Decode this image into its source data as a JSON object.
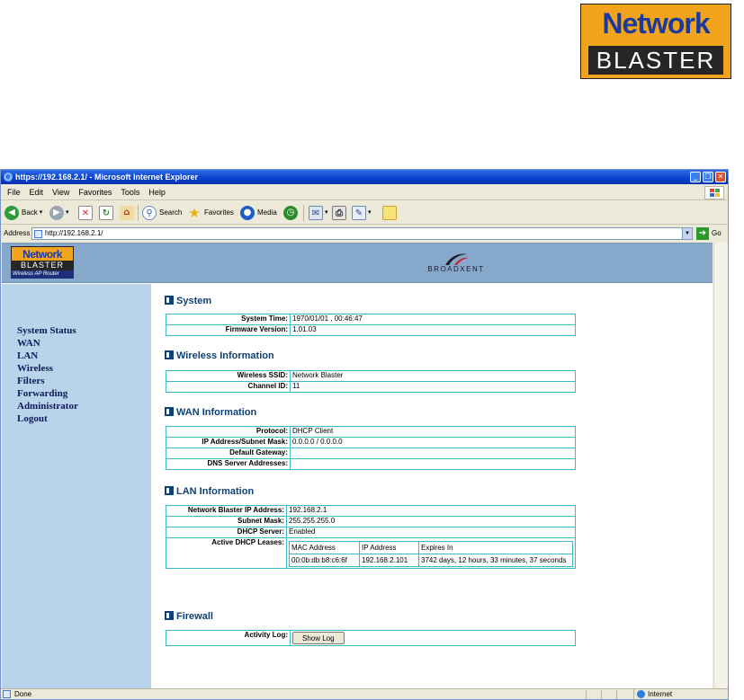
{
  "top_logo": {
    "word": "Network",
    "band": "BLASTER"
  },
  "browser": {
    "title": "https://192.168.2.1/ - Microsoft Internet Explorer",
    "menu": [
      "File",
      "Edit",
      "View",
      "Favorites",
      "Tools",
      "Help"
    ],
    "toolbar": {
      "back": "Back",
      "search": "Search",
      "favorites": "Favorites",
      "media": "Media"
    },
    "address": {
      "label": "Address",
      "url": "http://192.168.2.1/",
      "go": "Go"
    },
    "status": {
      "text": "Done",
      "zone": "Internet"
    }
  },
  "page": {
    "logo": {
      "top": "Network",
      "middle": "BLASTER",
      "sub": "Wireless AP Router"
    },
    "brand": "BROADXENT",
    "nav": [
      "System Status",
      "WAN",
      "LAN",
      "Wireless",
      "Filters",
      "Forwarding",
      "Administrator",
      "Logout"
    ],
    "system": {
      "heading": "System",
      "rows": [
        {
          "label": "System Time:",
          "value": " 1970/01/01 , 00:46:47"
        },
        {
          "label": "Firmware Version:",
          "value": "1.01.03"
        }
      ]
    },
    "wireless": {
      "heading": "Wireless Information",
      "rows": [
        {
          "label": "Wireless SSID:",
          "value": "Network Blaster"
        },
        {
          "label": "Channel ID:",
          "value": "11"
        }
      ]
    },
    "wan": {
      "heading": "WAN Information",
      "rows": [
        {
          "label": "Protocol:",
          "value": "DHCP Client"
        },
        {
          "label": "IP Address/Subnet Mask:",
          "value": "0.0.0.0 / 0.0.0.0"
        },
        {
          "label": "Default Gateway:",
          "value": ""
        },
        {
          "label": "DNS Server Addresses:",
          "value": ""
        }
      ]
    },
    "lan": {
      "heading": "LAN Information",
      "rows": [
        {
          "label": "Network Blaster IP Address:",
          "value": "192.168.2.1"
        },
        {
          "label": "Subnet Mask:",
          "value": "255.255.255.0"
        },
        {
          "label": "DHCP Server:",
          "value": "Enabled"
        }
      ],
      "leases_label": "Active DHCP Leases:",
      "leases_headers": [
        "MAC Address",
        "IP Address",
        "Expires In"
      ],
      "leases": [
        {
          "mac": "00:0b:db:b8:c6:6f",
          "ip": "192.168.2.101",
          "expires": "3742 days, 12 hours, 33 minutes, 37 seconds"
        }
      ]
    },
    "firewall": {
      "heading": "Firewall",
      "activity_label": "Activity Log:",
      "show_log": "Show Log"
    }
  }
}
